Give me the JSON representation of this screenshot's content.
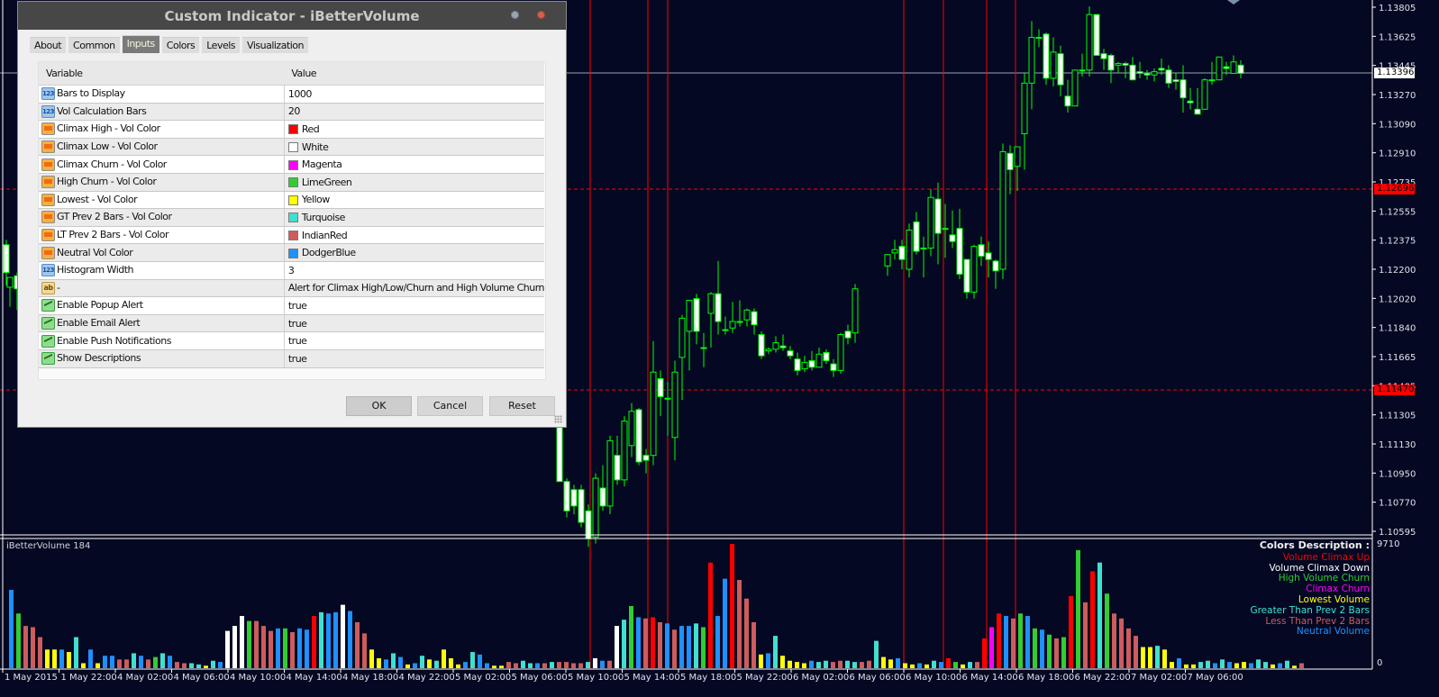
{
  "dialog": {
    "title": "Custom Indicator - iBetterVolume",
    "tabs": [
      {
        "label": "About",
        "active": false
      },
      {
        "label": "Common",
        "active": false
      },
      {
        "label": "Inputs",
        "active": true
      },
      {
        "label": "Colors",
        "active": false
      },
      {
        "label": "Levels",
        "active": false
      },
      {
        "label": "Visualization",
        "active": false
      }
    ],
    "columns": {
      "variable": "Variable",
      "value": "Value"
    },
    "params": [
      {
        "type": "num",
        "variable": "Bars to Display",
        "value": "1000"
      },
      {
        "type": "num",
        "variable": "Vol Calculation Bars",
        "value": "20"
      },
      {
        "type": "color",
        "variable": "Climax High - Vol Color",
        "value": "Red",
        "swatch": "#ff0000"
      },
      {
        "type": "color",
        "variable": "Climax Low - Vol Color",
        "value": "White",
        "swatch": "#ffffff"
      },
      {
        "type": "color",
        "variable": "Climax Churn - Vol Color",
        "value": "Magenta",
        "swatch": "#ff00ff"
      },
      {
        "type": "color",
        "variable": "High Churn - Vol Color",
        "value": "LimeGreen",
        "swatch": "#32cd32"
      },
      {
        "type": "color",
        "variable": "Lowest - Vol Color",
        "value": "Yellow",
        "swatch": "#ffff00"
      },
      {
        "type": "color",
        "variable": "GT Prev 2 Bars - Vol Color",
        "value": "Turquoise",
        "swatch": "#40e0d0"
      },
      {
        "type": "color",
        "variable": "LT Prev 2 Bars - Vol Color",
        "value": "IndianRed",
        "swatch": "#cd5c5c"
      },
      {
        "type": "color",
        "variable": "Neutral Vol Color",
        "value": "DodgerBlue",
        "swatch": "#1e90ff"
      },
      {
        "type": "num",
        "variable": "Histogram Width",
        "value": "3"
      },
      {
        "type": "str",
        "variable": "-",
        "value": "Alert for Climax High/Low/Churn and High Volume Churn"
      },
      {
        "type": "bool",
        "variable": "Enable Popup Alert",
        "value": "true"
      },
      {
        "type": "bool",
        "variable": "Enable Email Alert",
        "value": "true"
      },
      {
        "type": "bool",
        "variable": "Enable Push Notifications",
        "value": "true"
      },
      {
        "type": "bool",
        "variable": "Show Descriptions",
        "value": "true"
      }
    ],
    "buttons": {
      "ok": "OK",
      "cancel": "Cancel",
      "reset": "Reset"
    }
  },
  "chart": {
    "price_axis": [
      "1.13805",
      "1.13625",
      "1.13445",
      "1.13270",
      "1.13090",
      "1.12910",
      "1.12735",
      "1.12555",
      "1.12375",
      "1.12200",
      "1.12020",
      "1.11840",
      "1.11665",
      "1.11485",
      "1.11305",
      "1.11130",
      "1.10950",
      "1.10770",
      "1.10595"
    ],
    "current_price": "1.13396",
    "level_tags": [
      {
        "price": "1.12696",
        "color": "#ff0000"
      },
      {
        "price": "1.11470",
        "color": "#ff0000"
      }
    ],
    "time_axis": [
      "1 May 2015",
      "1 May 22:00",
      "4 May 02:00",
      "4 May 06:00",
      "4 May 10:00",
      "4 May 14:00",
      "4 May 18:00",
      "4 May 22:00",
      "5 May 02:00",
      "5 May 06:00",
      "5 May 10:00",
      "5 May 14:00",
      "5 May 18:00",
      "5 May 22:00",
      "6 May 02:00",
      "6 May 06:00",
      "6 May 10:00",
      "6 May 14:00",
      "6 May 18:00",
      "6 May 22:00",
      "7 May 02:00",
      "7 May 06:00"
    ],
    "candle_color": "#00ff00",
    "bull_fill": "#040822",
    "bear_fill": "#ffffff"
  },
  "indicator": {
    "name": "iBetterVolume 184",
    "scale_max": "9710",
    "scale_min": "0",
    "legend_title": "Colors Description :",
    "legend": [
      {
        "label": "Volume Climax Up",
        "color": "#ff0000"
      },
      {
        "label": "Volume Climax Down",
        "color": "#ffffff"
      },
      {
        "label": "High Volume Churn",
        "color": "#32cd32"
      },
      {
        "label": "Climax Churn",
        "color": "#ff00ff"
      },
      {
        "label": "Lowest Volume",
        "color": "#ffff00"
      },
      {
        "label": "Greater Than Prev 2 Bars",
        "color": "#40e0d0"
      },
      {
        "label": "Less Than Prev 2 Bars",
        "color": "#cd5c5c"
      },
      {
        "label": "Neutral Volume",
        "color": "#1e90ff"
      }
    ]
  }
}
